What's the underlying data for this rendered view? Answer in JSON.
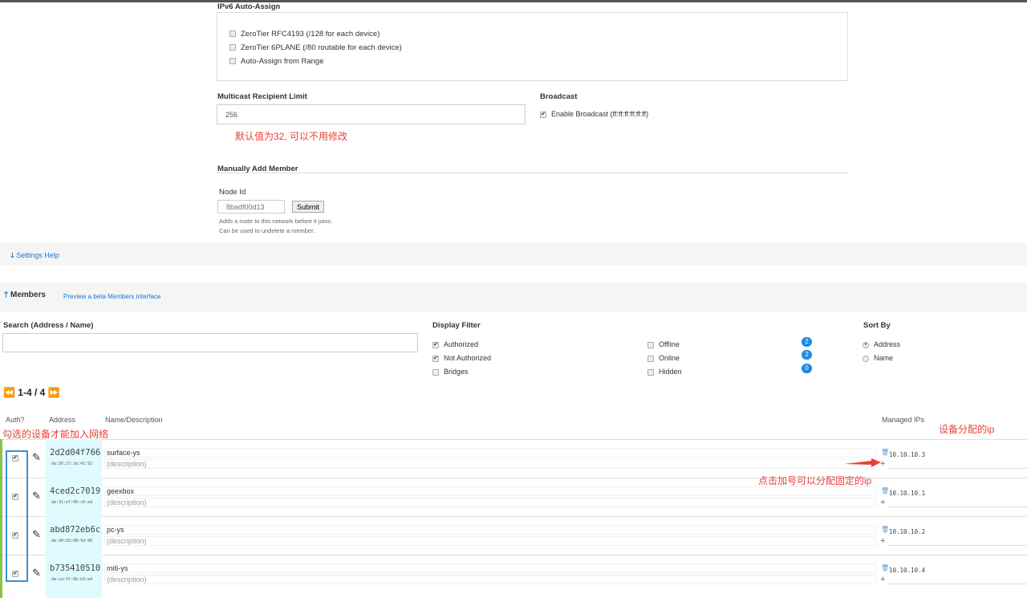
{
  "ipv6": {
    "title": "IPv6 Auto-Assign",
    "options": [
      "ZeroTier RFC4193 (/128 for each device)",
      "ZeroTier 6PLANE (/80 routable for each device)",
      "Auto-Assign from Range"
    ]
  },
  "multicast": {
    "label": "Multicast Recipient Limit",
    "value": "256",
    "note": "默认值为32, 可以不用修改"
  },
  "broadcast": {
    "label": "Broadcast",
    "option": "Enable Broadcast (ff:ff:ff:ff:ff:ff)"
  },
  "manual": {
    "title": "Manually Add Member",
    "node_label": "Node Id",
    "placeholder": "8badf00d13",
    "submit": "Submit",
    "help1": "Adds a node to this network before it joins.",
    "help2": "Can be used to undelete a member."
  },
  "settings_help": "Settings Help",
  "members": {
    "title": "Members",
    "beta_link": "Preview a beta Members interface",
    "search_label": "Search (Address / Name)",
    "filter_label": "Display Filter",
    "sort_label": "Sort By",
    "filters": [
      {
        "label": "Authorized",
        "checked": true
      },
      {
        "label": "Not Authorized",
        "checked": true
      },
      {
        "label": "Bridges",
        "checked": false
      }
    ],
    "status_filters": [
      {
        "label": "Offline",
        "count": "2"
      },
      {
        "label": "Online",
        "count": "2"
      },
      {
        "label": "Hidden",
        "count": "0"
      }
    ],
    "sort": [
      "Address",
      "Name"
    ],
    "pager": "1-4 / 4",
    "headers": {
      "auth": "Auth?",
      "address": "Address",
      "name": "Name/Description",
      "ips": "Managed IPs"
    },
    "rows": [
      {
        "address": "2d2d04f766",
        "mac": "da:50:27:2e:41:92",
        "name": "surface-ys",
        "desc": "(description)",
        "ip": "10.10.10.3"
      },
      {
        "address": "4ced2c7019",
        "mac": "da:31:e7:06:c6:ed",
        "name": "geexbox",
        "desc": "(description)",
        "ip": "10.10.10.1"
      },
      {
        "address": "abd872eb6c",
        "mac": "da:d0:d2:08:5d:06",
        "name": "pc-ys",
        "desc": "(description)",
        "ip": "10.10.10.2"
      },
      {
        "address": "b735410510",
        "mac": "da:ca:3f:6b:b3:e4",
        "name": "mi6-ys",
        "desc": "(description)",
        "ip": "10.10.10.4"
      }
    ]
  },
  "annotations": {
    "auth": "勾选的设备才能加入网络",
    "ips": "设备分配的ip",
    "plus": "点击加号可以分配固定的ip"
  }
}
